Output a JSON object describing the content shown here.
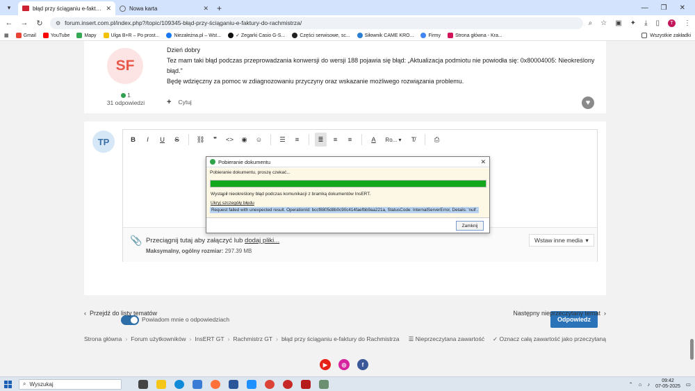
{
  "browser": {
    "tabs": [
      {
        "title": "błąd przy ściąganiu e-faktury do"
      },
      {
        "title": "Nowa karta"
      }
    ],
    "url": "forum.insert.com.pl/index.php?/topic/109345-błąd-przy-ściąganiu-e-faktury-do-rachmistrza/",
    "avatar_letter": "T",
    "bookmarks": [
      "Gmail",
      "YouTube",
      "Mapy",
      "Ulga B+R – Po prost...",
      "Niezależna.pl – Wst...",
      "✓ Zegarki Casio G-S...",
      "Części serwisowe, sc...",
      "Siłownik CAME KRO...",
      "Firmy",
      "Strona główna - Kra..."
    ],
    "all_bookmarks": "Wszystkie zakładki"
  },
  "post": {
    "avatar": "SF",
    "reputation": "1",
    "answers": "31 odpowiedzi",
    "greeting": "Dzień dobry",
    "line1": "Tez mam taki błąd podczas przeprowadzania konwersji do wersji 188 pojawia się błąd: „Aktualizacja podmiotu nie powiodła się: 0x80004005: Nieokreślony błąd.\"",
    "line2": "Będę wdzięczny za pomoc w zdiagnozowaniu przyczyny oraz wskazanie możliwego rozwiązania problemu.",
    "quote": "Cytuj"
  },
  "reply": {
    "avatar": "TP",
    "font_select": "Ro...",
    "attach_text": "Przeciągnij tutaj aby załączyć lub",
    "attach_link": "dodaj pliki...",
    "max_size_label": "Maksymalny, ogólny rozmiar:",
    "max_size_value": "297.39 MB",
    "media_button": "Wstaw inne media",
    "notify": "Powiadom mnie o odpowiedziach",
    "submit": "Odpowiedz"
  },
  "nav": {
    "prev": "Przejdź do listy tematów",
    "next": "Następny nieprzeczytany temat"
  },
  "breadcrumb": [
    "Strona główna",
    "Forum użytkowników",
    "InsERT GT",
    "Rachmistrz GT",
    "błąd przy ściąganiu e-faktury do Rachmistrza"
  ],
  "breadcrumb_right": [
    "Nieprzeczytana zawartość",
    "Oznacz całą zawartość jako przeczytaną"
  ],
  "dialog": {
    "title": "Pobieranie dokumentu",
    "status": "Pobieranie dokumentu, proszę czekać...",
    "progress": 1.0,
    "error": "Wystąpił nieokreślony błąd podczas komunikacji z bramką dokumentów InsERT.",
    "hide_details": "Ukryj szczegóły błędu",
    "details": "Request failed with unexpected result. OperationId: bccf8805d8b0c90c414faefbb9aa221a, StatusCode: InternalServerError, Details: 'null'.",
    "close_button": "Zamknij"
  },
  "taskbar": {
    "search": "Wyszukaj",
    "time": "09:42",
    "date": "07-05-2025"
  },
  "colors": {
    "accent": "#2a73b8",
    "progress": "#13a81c"
  }
}
